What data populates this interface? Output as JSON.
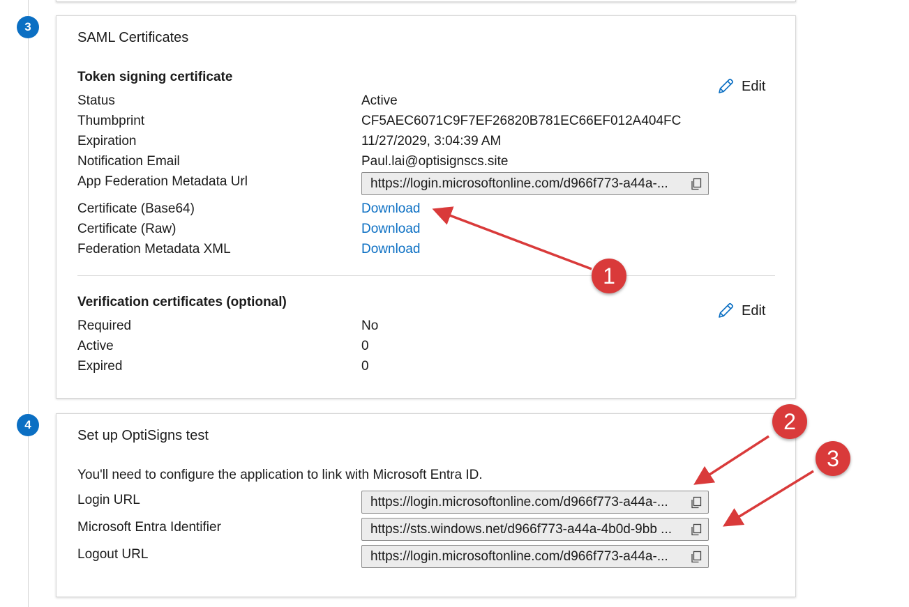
{
  "steps": {
    "saml": {
      "number": "3",
      "title": "SAML Certificates",
      "token_signing": {
        "heading": "Token signing certificate",
        "edit_label": "Edit",
        "rows": [
          {
            "label": "Status",
            "value": "Active"
          },
          {
            "label": "Thumbprint",
            "value": "CF5AEC6071C9F7EF26820B781EC66EF012A404FC"
          },
          {
            "label": "Expiration",
            "value": "11/27/2029, 3:04:39 AM"
          },
          {
            "label": "Notification Email",
            "value": "Paul.lai@optisignscs.site"
          }
        ],
        "metadata_url": {
          "label": "App Federation Metadata Url",
          "value": "https://login.microsoftonline.com/d966f773-a44a-..."
        },
        "downloads": [
          {
            "label": "Certificate (Base64)",
            "link": "Download"
          },
          {
            "label": "Certificate (Raw)",
            "link": "Download"
          },
          {
            "label": "Federation Metadata XML",
            "link": "Download"
          }
        ]
      },
      "verification": {
        "heading": "Verification certificates (optional)",
        "edit_label": "Edit",
        "rows": [
          {
            "label": "Required",
            "value": "No"
          },
          {
            "label": "Active",
            "value": "0"
          },
          {
            "label": "Expired",
            "value": "0"
          }
        ]
      }
    },
    "setup": {
      "number": "4",
      "title": "Set up OptiSigns test",
      "intro": "You'll need to configure the application to link with Microsoft Entra ID.",
      "fields": [
        {
          "label": "Login URL",
          "value": "https://login.microsoftonline.com/d966f773-a44a-..."
        },
        {
          "label": "Microsoft Entra Identifier",
          "value": "https://sts.windows.net/d966f773-a44a-4b0d-9bb ..."
        },
        {
          "label": "Logout URL",
          "value": "https://login.microsoftonline.com/d966f773-a44a-..."
        }
      ]
    }
  },
  "annotations": [
    "1",
    "2",
    "3"
  ],
  "colors": {
    "accent": "#0b6fc3",
    "annotation": "#d93a3a"
  },
  "icons": {
    "edit": "pencil-icon",
    "copy": "copy-icon"
  }
}
